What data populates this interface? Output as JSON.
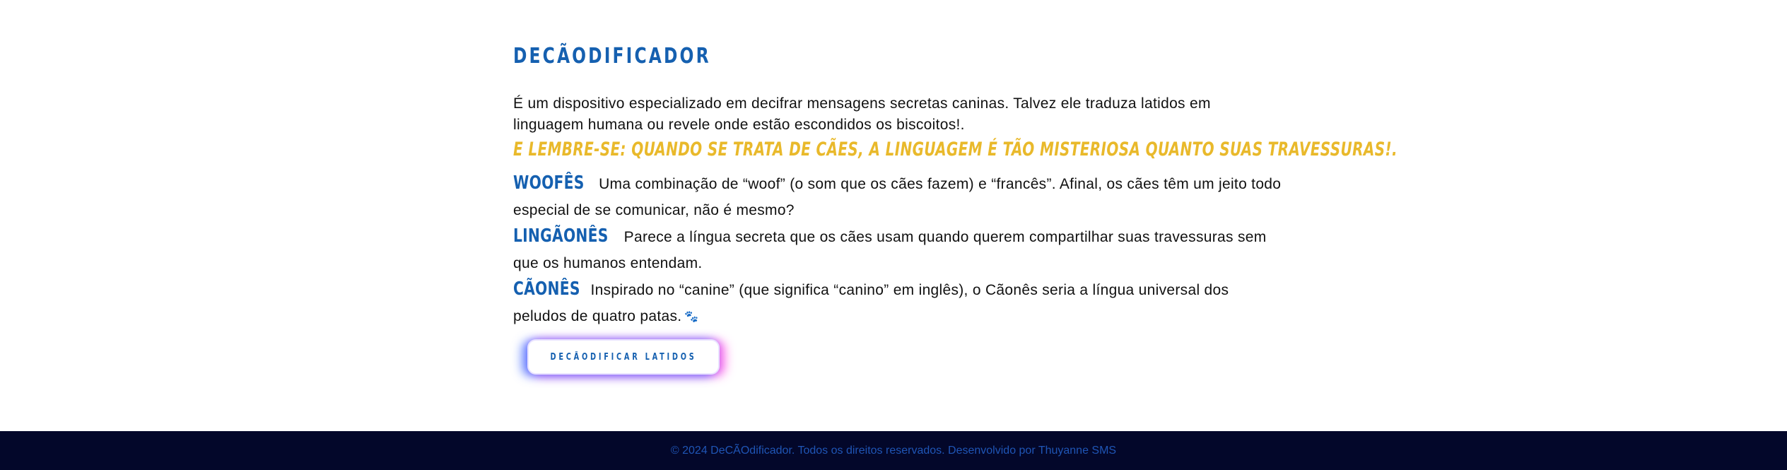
{
  "main": {
    "title": "DECÃODIFICADOR",
    "intro": "É um dispositivo especializado em decifrar mensagens secretas caninas. Talvez ele traduza latidos em linguagem humana ou revele onde estão escondidos os biscoitos!.",
    "remember": "E LEMBRE-SE: QUANDO SE TRATA DE CÃES, A LINGUAGEM É TÃO MISTERIOSA QUANTO SUAS TRAVESSURAS!.",
    "terms": [
      {
        "word": "WOOFÊS",
        "description": "Uma combinação de “woof” (o som que os cães fazem) e “francês”. Afinal, os cães têm um jeito todo especial de se comunicar, não é mesmo?"
      },
      {
        "word": "LINGÃONÊS",
        "description": "Parece a língua secreta que os cães usam quando querem compartilhar suas travessuras sem que os humanos entendam."
      },
      {
        "word": "CÃONÊS",
        "description": "Inspirado no “canine” (que significa “canino” em inglês), o Cãonês seria a língua universal dos peludos de quatro patas."
      }
    ],
    "paw_glyph": "🐾",
    "button_label": "DECÃODIFICAR LATIDOS"
  },
  "footer": {
    "text": "© 2024 DeCÃOdificador. Todos os direitos reservados. Desenvolvido por Thuyanne SMS"
  },
  "colors": {
    "accent_blue": "#1560b0",
    "accent_yellow": "#e9b92b",
    "footer_bg": "#03072a"
  }
}
